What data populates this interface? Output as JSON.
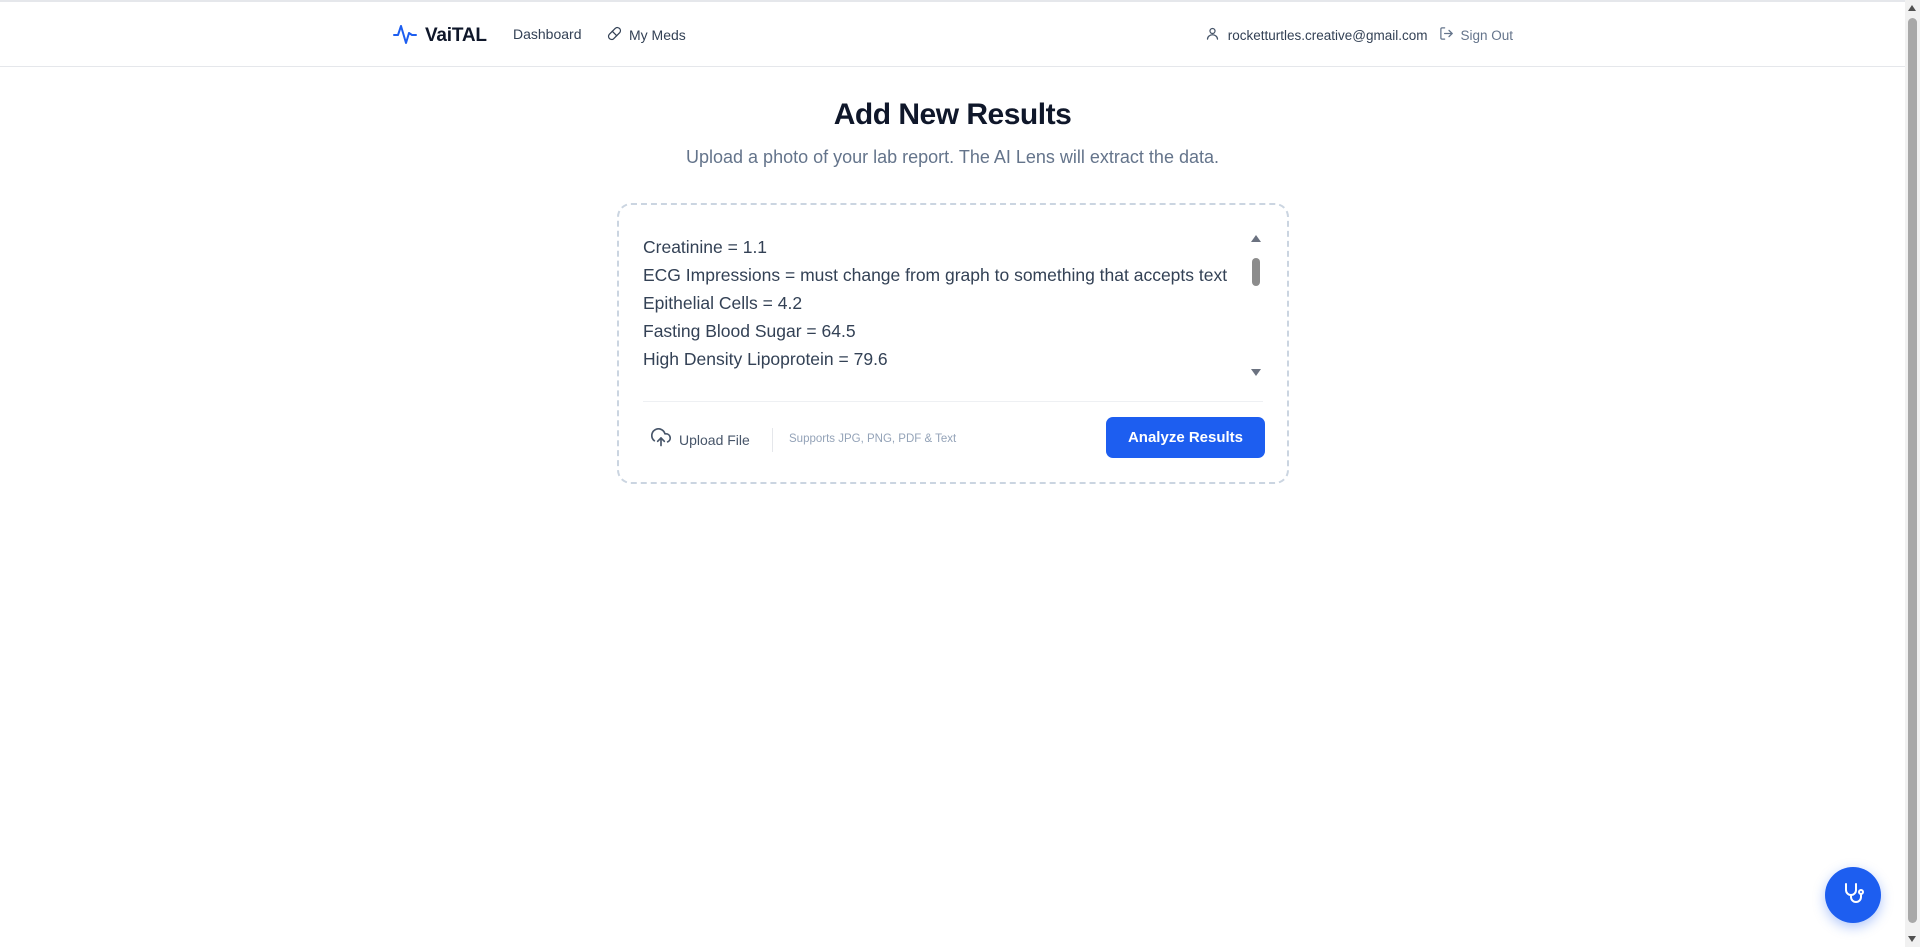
{
  "header": {
    "brand": "VaiTAL",
    "nav": {
      "dashboard": "Dashboard",
      "my_meds": "My Meds"
    },
    "user_email": "rocketturtles.creative@gmail.com",
    "sign_out": "Sign Out"
  },
  "main": {
    "title": "Add New Results",
    "subtitle": "Upload a photo of your lab report. The AI Lens will extract the data.",
    "results_lines": [
      "Creatinine = 1.1",
      "ECG Impressions = must change from graph to something that accepts text",
      "Epithelial Cells = 4.2",
      "Fasting Blood Sugar = 64.5",
      "High Density Lipoprotein = 79.6"
    ],
    "upload_label": "Upload File",
    "supports_text": "Supports JPG, PNG, PDF & Text",
    "analyze_label": "Analyze Results"
  },
  "colors": {
    "accent": "#1d5ef0",
    "title": "#0f172a",
    "muted": "#64748b"
  },
  "icons": {
    "brand": "pulse-icon",
    "meds": "pill-icon",
    "user": "user-icon",
    "sign_out": "sign-out-icon",
    "upload": "cloud-upload-icon",
    "fab": "stethoscope-icon"
  }
}
